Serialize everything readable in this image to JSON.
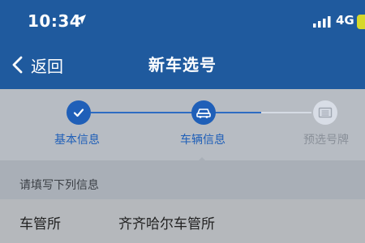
{
  "status_bar": {
    "time": "10:34",
    "network": "4G",
    "location_icon": "location-arrow-icon",
    "signal_icon": "signal-bars-icon",
    "battery_icon": "battery-icon"
  },
  "nav": {
    "back_label": "返回",
    "title": "新车选号",
    "back_icon": "chevron-left-icon"
  },
  "steps": [
    {
      "label": "基本信息",
      "state": "completed",
      "icon": "check-icon"
    },
    {
      "label": "车辆信息",
      "state": "current",
      "icon": "car-icon"
    },
    {
      "label": "预选号牌",
      "state": "pending",
      "icon": "license-plate-icon"
    }
  ],
  "form": {
    "section_title": "请填写下列信息",
    "fields": [
      {
        "label": "车管所",
        "value": "齐齐哈尔车管所"
      }
    ]
  },
  "colors": {
    "header_blue": "#1f5a9e",
    "step_active": "#1f5fb8",
    "step_inactive": "#d8dde6"
  }
}
